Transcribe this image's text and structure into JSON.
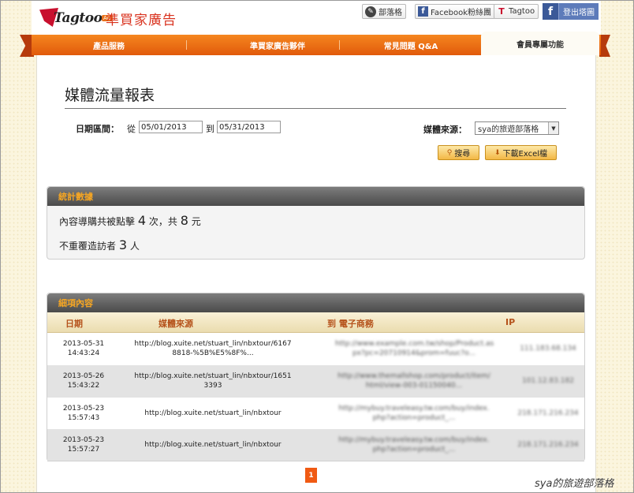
{
  "brand": {
    "logo_text": "Tagtoo",
    "logo_badge": "AD",
    "title": "準買家廣告"
  },
  "top_links": {
    "blog": "部落格",
    "facebook_fans": "Facebook粉絲團",
    "tagtoo": "Tagtoo",
    "logout": "登出塔圖"
  },
  "nav": {
    "items": [
      {
        "label": "產品服務"
      },
      {
        "label": "準買家廣告夥伴"
      },
      {
        "label": "常見問題 Q&A"
      },
      {
        "label": "會員專屬功能"
      }
    ]
  },
  "page": {
    "title": "媒體流量報表"
  },
  "filters": {
    "date_range_label": "日期區間：",
    "from_label": "從",
    "from_value": "05/01/2013",
    "to_label": "到",
    "to_value": "05/31/2013",
    "media_source_label": "媒體來源：",
    "media_source_value": "sya的旅遊部落格"
  },
  "actions": {
    "search": "搜尋",
    "download_excel": "下載Excel檔"
  },
  "stats": {
    "heading": "統計數據",
    "line1_prefix": "內容導購共被點擊",
    "clicks": "4",
    "line1_mid": "次，共",
    "amount": "8",
    "line1_suffix": "元",
    "line2_prefix": "不重覆造訪者",
    "visitors": "3",
    "line2_suffix": "人"
  },
  "details": {
    "heading": "細項內容",
    "columns": {
      "date": "日期",
      "media_source": "媒體來源",
      "to_shop": "到 電子商務",
      "ip": "IP"
    },
    "rows": [
      {
        "date": "2013-05-31",
        "time": "14:43:24",
        "source_line1": "http://blog.xuite.net/stuart_lin/nbxtour/6167",
        "source_line2": "8818-%5B%E5%8F%...",
        "shop_line1": "http://www.example.com.tw/shop/Product.as",
        "shop_line2": "px?pc=20710914&prom=fuuc?o...",
        "ip": "111.183.68.134"
      },
      {
        "date": "2013-05-26",
        "time": "15:43:22",
        "source_line1": "http://blog.xuite.net/stuart_lin/nbxtour/1651",
        "source_line2": "3393",
        "shop_line1": "http://www.themallshop.com/product/item/",
        "shop_line2": "html/view-003-01150040...",
        "ip": "101.12.83.182"
      },
      {
        "date": "2013-05-23",
        "time": "15:57:43",
        "source_line1": "http://blog.xuite.net/stuart_lin/nbxtour",
        "source_line2": "",
        "shop_line1": "http://mybuy.traveleasy.tw.com/buy/index.",
        "shop_line2": "php?action=product_...",
        "ip": "218.171.216.234"
      },
      {
        "date": "2013-05-23",
        "time": "15:57:27",
        "source_line1": "http://blog.xuite.net/stuart_lin/nbxtour",
        "source_line2": "",
        "shop_line1": "http://mybuy.traveleasy.tw.com/buy/index.",
        "shop_line2": "php?action=product_...",
        "ip": "218.171.216.234"
      }
    ]
  },
  "pagination": {
    "current": "1"
  },
  "watermark": "sya的旅遊部落格"
}
